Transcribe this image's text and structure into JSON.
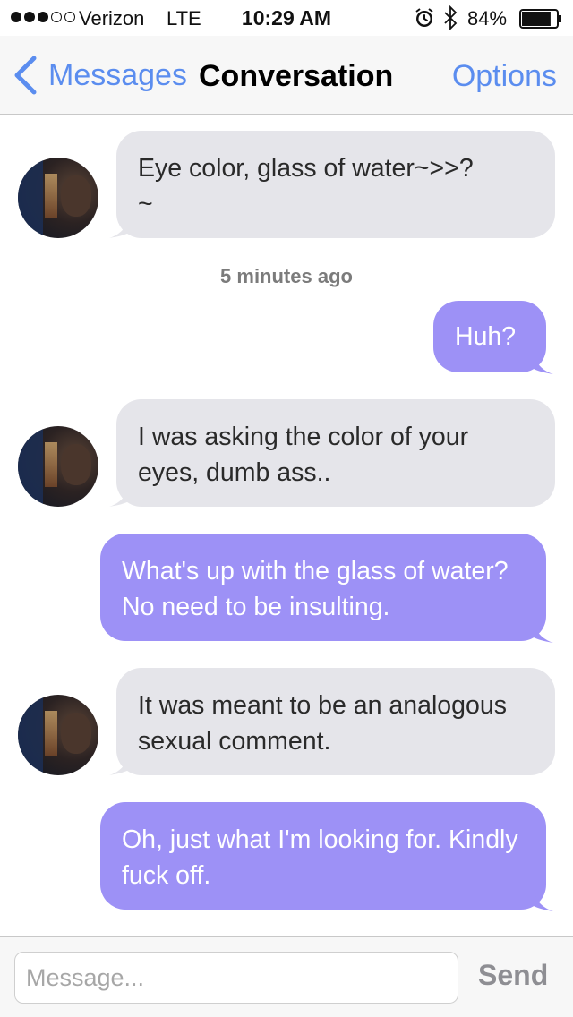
{
  "status_bar": {
    "carrier": "Verizon",
    "network": "LTE",
    "time": "10:29 AM",
    "battery_percent": "84%",
    "battery_level": 0.84,
    "signal_bars_filled": 3,
    "signal_bars_total": 5,
    "icons": [
      "alarm-icon",
      "bluetooth-icon",
      "battery-icon"
    ]
  },
  "nav": {
    "back_label": "Messages",
    "title": "Conversation",
    "options_label": "Options"
  },
  "messages": [
    {
      "side": "in",
      "text": "Eye color, glass of water~>>?\n~"
    },
    {
      "side": "meta",
      "text": "5 minutes ago"
    },
    {
      "side": "out",
      "text": "Huh?"
    },
    {
      "side": "in",
      "text": "I was asking the color of your eyes, dumb ass.."
    },
    {
      "side": "out",
      "text": "What's up with the glass of water? No need to be insulting."
    },
    {
      "side": "in",
      "text": "It was meant to be an analogous sexual comment."
    },
    {
      "side": "out",
      "text": "Oh, just what I'm looking for. Kindly fuck off."
    }
  ],
  "composer": {
    "placeholder": "Message...",
    "value": "",
    "send_label": "Send"
  },
  "colors": {
    "accent": "#5b8def",
    "incoming_bubble": "#e5e5ea",
    "outgoing_bubble": "#9d91f6",
    "send_disabled": "#8e8e93"
  }
}
